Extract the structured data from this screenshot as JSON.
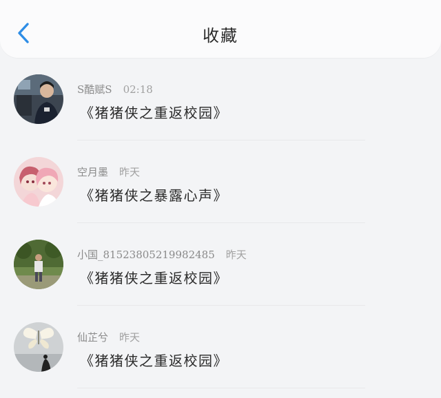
{
  "header": {
    "title": "收藏",
    "back_icon": "chevron-left-icon",
    "accent_color": "#2e8de6"
  },
  "items": [
    {
      "name": "S酷赋S",
      "time": "02:18",
      "message": "《猪猪侠之重返校园》",
      "avatar": "avatar-person-photo"
    },
    {
      "name": "空月墨",
      "time": "昨天",
      "message": "《猪猪侠之暴露心声》",
      "avatar": "avatar-anime-girls"
    },
    {
      "name": "小国_81523805219982485",
      "time": "昨天",
      "message": "《猪猪侠之重返校园》",
      "avatar": "avatar-outdoor-photo"
    },
    {
      "name": "仙芷兮",
      "time": "昨天",
      "message": "《猪猪侠之重返校园》",
      "avatar": "avatar-butterfly-art"
    }
  ]
}
